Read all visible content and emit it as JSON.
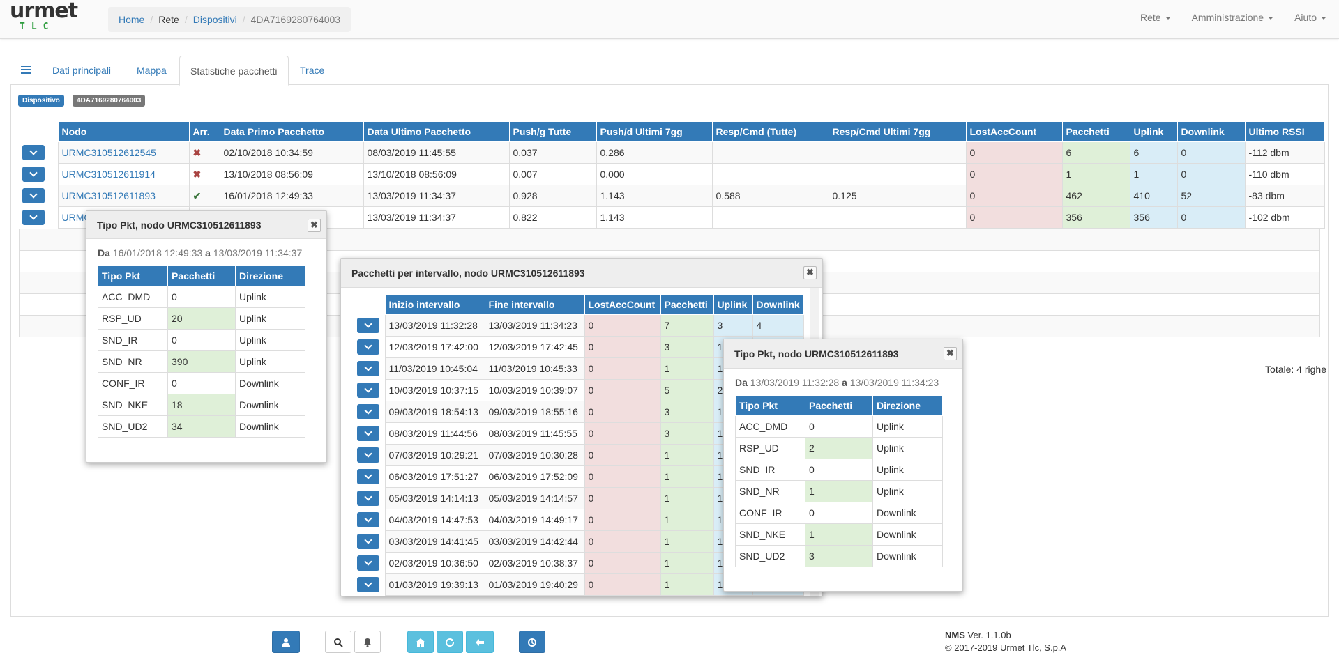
{
  "brand": {
    "name": "urmet",
    "sub": "TLC"
  },
  "breadcrumb": [
    "Home",
    "Rete",
    "Dispositivi",
    "4DA7169280764003"
  ],
  "topmenu": [
    "Rete",
    "Amministrazione",
    "Aiuto"
  ],
  "tabs": [
    "Dati principali",
    "Mappa",
    "Statistiche pacchetti",
    "Trace"
  ],
  "labels": {
    "device": "Dispositivo",
    "device_id": "4DA7169280764003"
  },
  "main": {
    "headers": [
      "",
      "Nodo",
      "Arr.",
      "Data Primo Pacchetto",
      "Data Ultimo Pacchetto",
      "Push/g Tutte",
      "Push/d Ultimi 7gg",
      "Resp/Cmd (Tutte)",
      "Resp/Cmd Ultimi 7gg",
      "LostAccCount",
      "Pacchetti",
      "Uplink",
      "Downlink",
      "Ultimo RSSI"
    ],
    "rows": [
      {
        "nodo": "URMC310512612545",
        "arr": "x",
        "primo": "02/10/2018 10:34:59",
        "ultimo": "08/03/2019 11:45:55",
        "pushg": "0.037",
        "pushd": "0.286",
        "resp": "",
        "resp7": "",
        "lost": "0",
        "pkt": "6",
        "up": "6",
        "down": "0",
        "rssi": "-112 dbm"
      },
      {
        "nodo": "URMC310512611914",
        "arr": "x",
        "primo": "13/10/2018 08:56:09",
        "ultimo": "13/10/2018 08:56:09",
        "pushg": "0.007",
        "pushd": "0.000",
        "resp": "",
        "resp7": "",
        "lost": "0",
        "pkt": "1",
        "up": "1",
        "down": "0",
        "rssi": "-110 dbm"
      },
      {
        "nodo": "URMC310512611893",
        "arr": "v",
        "primo": "16/01/2018 12:49:33",
        "ultimo": "13/03/2019 11:34:37",
        "pushg": "0.928",
        "pushd": "1.143",
        "resp": "0.588",
        "resp7": "0.125",
        "lost": "0",
        "pkt": "462",
        "up": "410",
        "down": "52",
        "rssi": "-83 dbm"
      },
      {
        "nodo": "URMC",
        "arr": "",
        "primo": "",
        "ultimo": "13/03/2019 11:34:37",
        "pushg": "0.822",
        "pushd": "1.143",
        "resp": "",
        "resp7": "",
        "lost": "0",
        "pkt": "356",
        "up": "356",
        "down": "0",
        "rssi": "-102 dbm"
      }
    ],
    "total": "Totale: 4 righe"
  },
  "dlg1": {
    "title": "Tipo Pkt, nodo URMC310512611893",
    "da": "Da",
    "from": "16/01/2018 12:49:33",
    "a": "a",
    "to": "13/03/2019 11:34:37",
    "headers": [
      "Tipo Pkt",
      "Pacchetti",
      "Direzione"
    ],
    "rows": [
      [
        "ACC_DMD",
        "0",
        "Uplink"
      ],
      [
        "RSP_UD",
        "20",
        "Uplink"
      ],
      [
        "SND_IR",
        "0",
        "Uplink"
      ],
      [
        "SND_NR",
        "390",
        "Uplink"
      ],
      [
        "CONF_IR",
        "0",
        "Downlink"
      ],
      [
        "SND_NKE",
        "18",
        "Downlink"
      ],
      [
        "SND_UD2",
        "34",
        "Downlink"
      ]
    ]
  },
  "dlg2": {
    "title": "Pacchetti per intervallo, nodo URMC310512611893",
    "headers": [
      "",
      "Inizio intervallo",
      "Fine intervallo",
      "LostAccCount",
      "Pacchetti",
      "Uplink",
      "Downlink"
    ],
    "rows": [
      [
        "13/03/2019 11:32:28",
        "13/03/2019 11:34:23",
        "0",
        "7",
        "3",
        "4"
      ],
      [
        "12/03/2019 17:42:00",
        "12/03/2019 17:42:45",
        "0",
        "3",
        "1",
        ""
      ],
      [
        "11/03/2019 10:45:04",
        "11/03/2019 10:45:33",
        "0",
        "1",
        "1",
        ""
      ],
      [
        "10/03/2019 10:37:15",
        "10/03/2019 10:39:07",
        "0",
        "5",
        "2",
        ""
      ],
      [
        "09/03/2019 18:54:13",
        "09/03/2019 18:55:16",
        "0",
        "3",
        "1",
        ""
      ],
      [
        "08/03/2019 11:44:56",
        "08/03/2019 11:45:55",
        "0",
        "3",
        "1",
        ""
      ],
      [
        "07/03/2019 10:29:21",
        "07/03/2019 10:30:28",
        "0",
        "1",
        "1",
        ""
      ],
      [
        "06/03/2019 17:51:27",
        "06/03/2019 17:52:09",
        "0",
        "1",
        "1",
        ""
      ],
      [
        "05/03/2019 14:14:13",
        "05/03/2019 14:14:57",
        "0",
        "1",
        "1",
        ""
      ],
      [
        "04/03/2019 14:47:53",
        "04/03/2019 14:49:17",
        "0",
        "1",
        "1",
        ""
      ],
      [
        "03/03/2019 14:41:45",
        "03/03/2019 14:42:44",
        "0",
        "1",
        "1",
        ""
      ],
      [
        "02/03/2019 10:36:50",
        "02/03/2019 10:38:37",
        "0",
        "1",
        "1",
        ""
      ],
      [
        "01/03/2019 19:39:13",
        "01/03/2019 19:40:29",
        "0",
        "1",
        "1",
        ""
      ]
    ]
  },
  "dlg3": {
    "title": "Tipo Pkt, nodo URMC310512611893",
    "da": "Da",
    "from": "13/03/2019 11:32:28",
    "a": "a",
    "to": "13/03/2019 11:34:23",
    "headers": [
      "Tipo Pkt",
      "Pacchetti",
      "Direzione"
    ],
    "rows": [
      [
        "ACC_DMD",
        "0",
        "Uplink"
      ],
      [
        "RSP_UD",
        "2",
        "Uplink"
      ],
      [
        "SND_IR",
        "0",
        "Uplink"
      ],
      [
        "SND_NR",
        "1",
        "Uplink"
      ],
      [
        "CONF_IR",
        "0",
        "Downlink"
      ],
      [
        "SND_NKE",
        "1",
        "Downlink"
      ],
      [
        "SND_UD2",
        "3",
        "Downlink"
      ]
    ]
  },
  "footer": {
    "app": "NMS",
    "ver": "Ver. 1.1.0b",
    "copy": "© 2017-2019 Urmet Tlc, S.p.A"
  }
}
